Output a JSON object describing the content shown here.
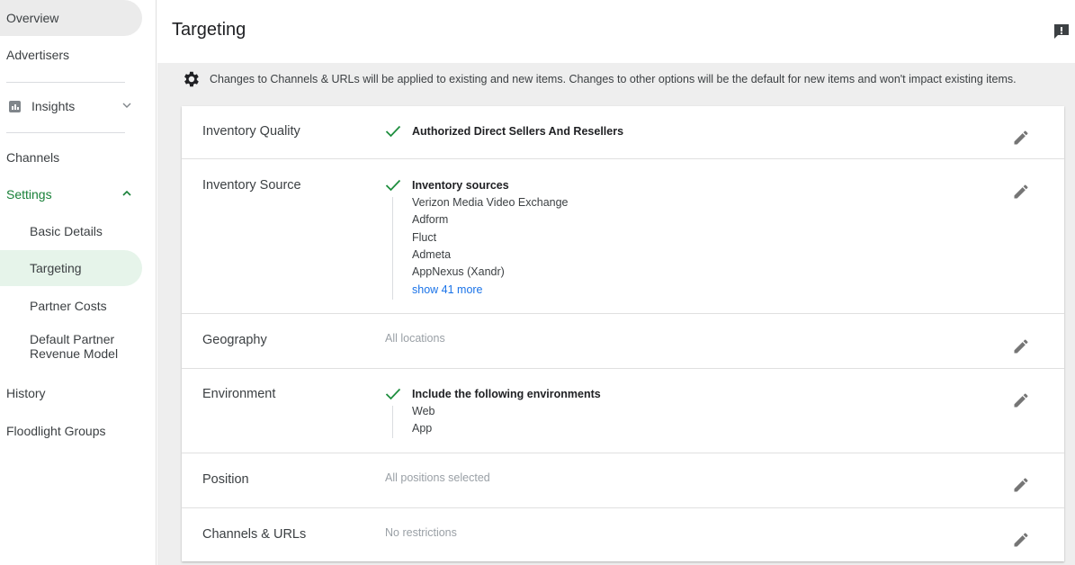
{
  "sidebar": {
    "overview": "Overview",
    "advertisers": "Advertisers",
    "insights": "Insights",
    "channels": "Channels",
    "settings": "Settings",
    "basic_details": "Basic Details",
    "targeting": "Targeting",
    "partner_costs": "Partner Costs",
    "default_partner_line1": "Default Partner",
    "default_partner_line2": "Revenue Model",
    "history": "History",
    "floodlight_groups": "Floodlight Groups"
  },
  "header": {
    "title": "Targeting"
  },
  "notice": "Changes to Channels & URLs will be applied to existing and new items. Changes to other options will be the default for new items and won't impact existing items.",
  "rows": {
    "inventory_quality": {
      "label": "Inventory Quality",
      "value": "Authorized Direct Sellers And Resellers"
    },
    "inventory_source": {
      "label": "Inventory Source",
      "title": "Inventory sources",
      "items": [
        "Verizon Media Video Exchange",
        "Adform",
        "Fluct",
        "Admeta",
        "AppNexus (Xandr)"
      ],
      "more_link": "show 41 more"
    },
    "geography": {
      "label": "Geography",
      "value": "All locations"
    },
    "environment": {
      "label": "Environment",
      "title": "Include the following environments",
      "items": [
        "Web",
        "App"
      ]
    },
    "position": {
      "label": "Position",
      "value": "All positions selected"
    },
    "channels_urls": {
      "label": "Channels & URLs",
      "value": "No restrictions"
    }
  },
  "colors": {
    "accent_green": "#188038",
    "check_green": "#1e8e3e",
    "link_blue": "#1a73e8",
    "active_bg": "#e6f4ea"
  }
}
